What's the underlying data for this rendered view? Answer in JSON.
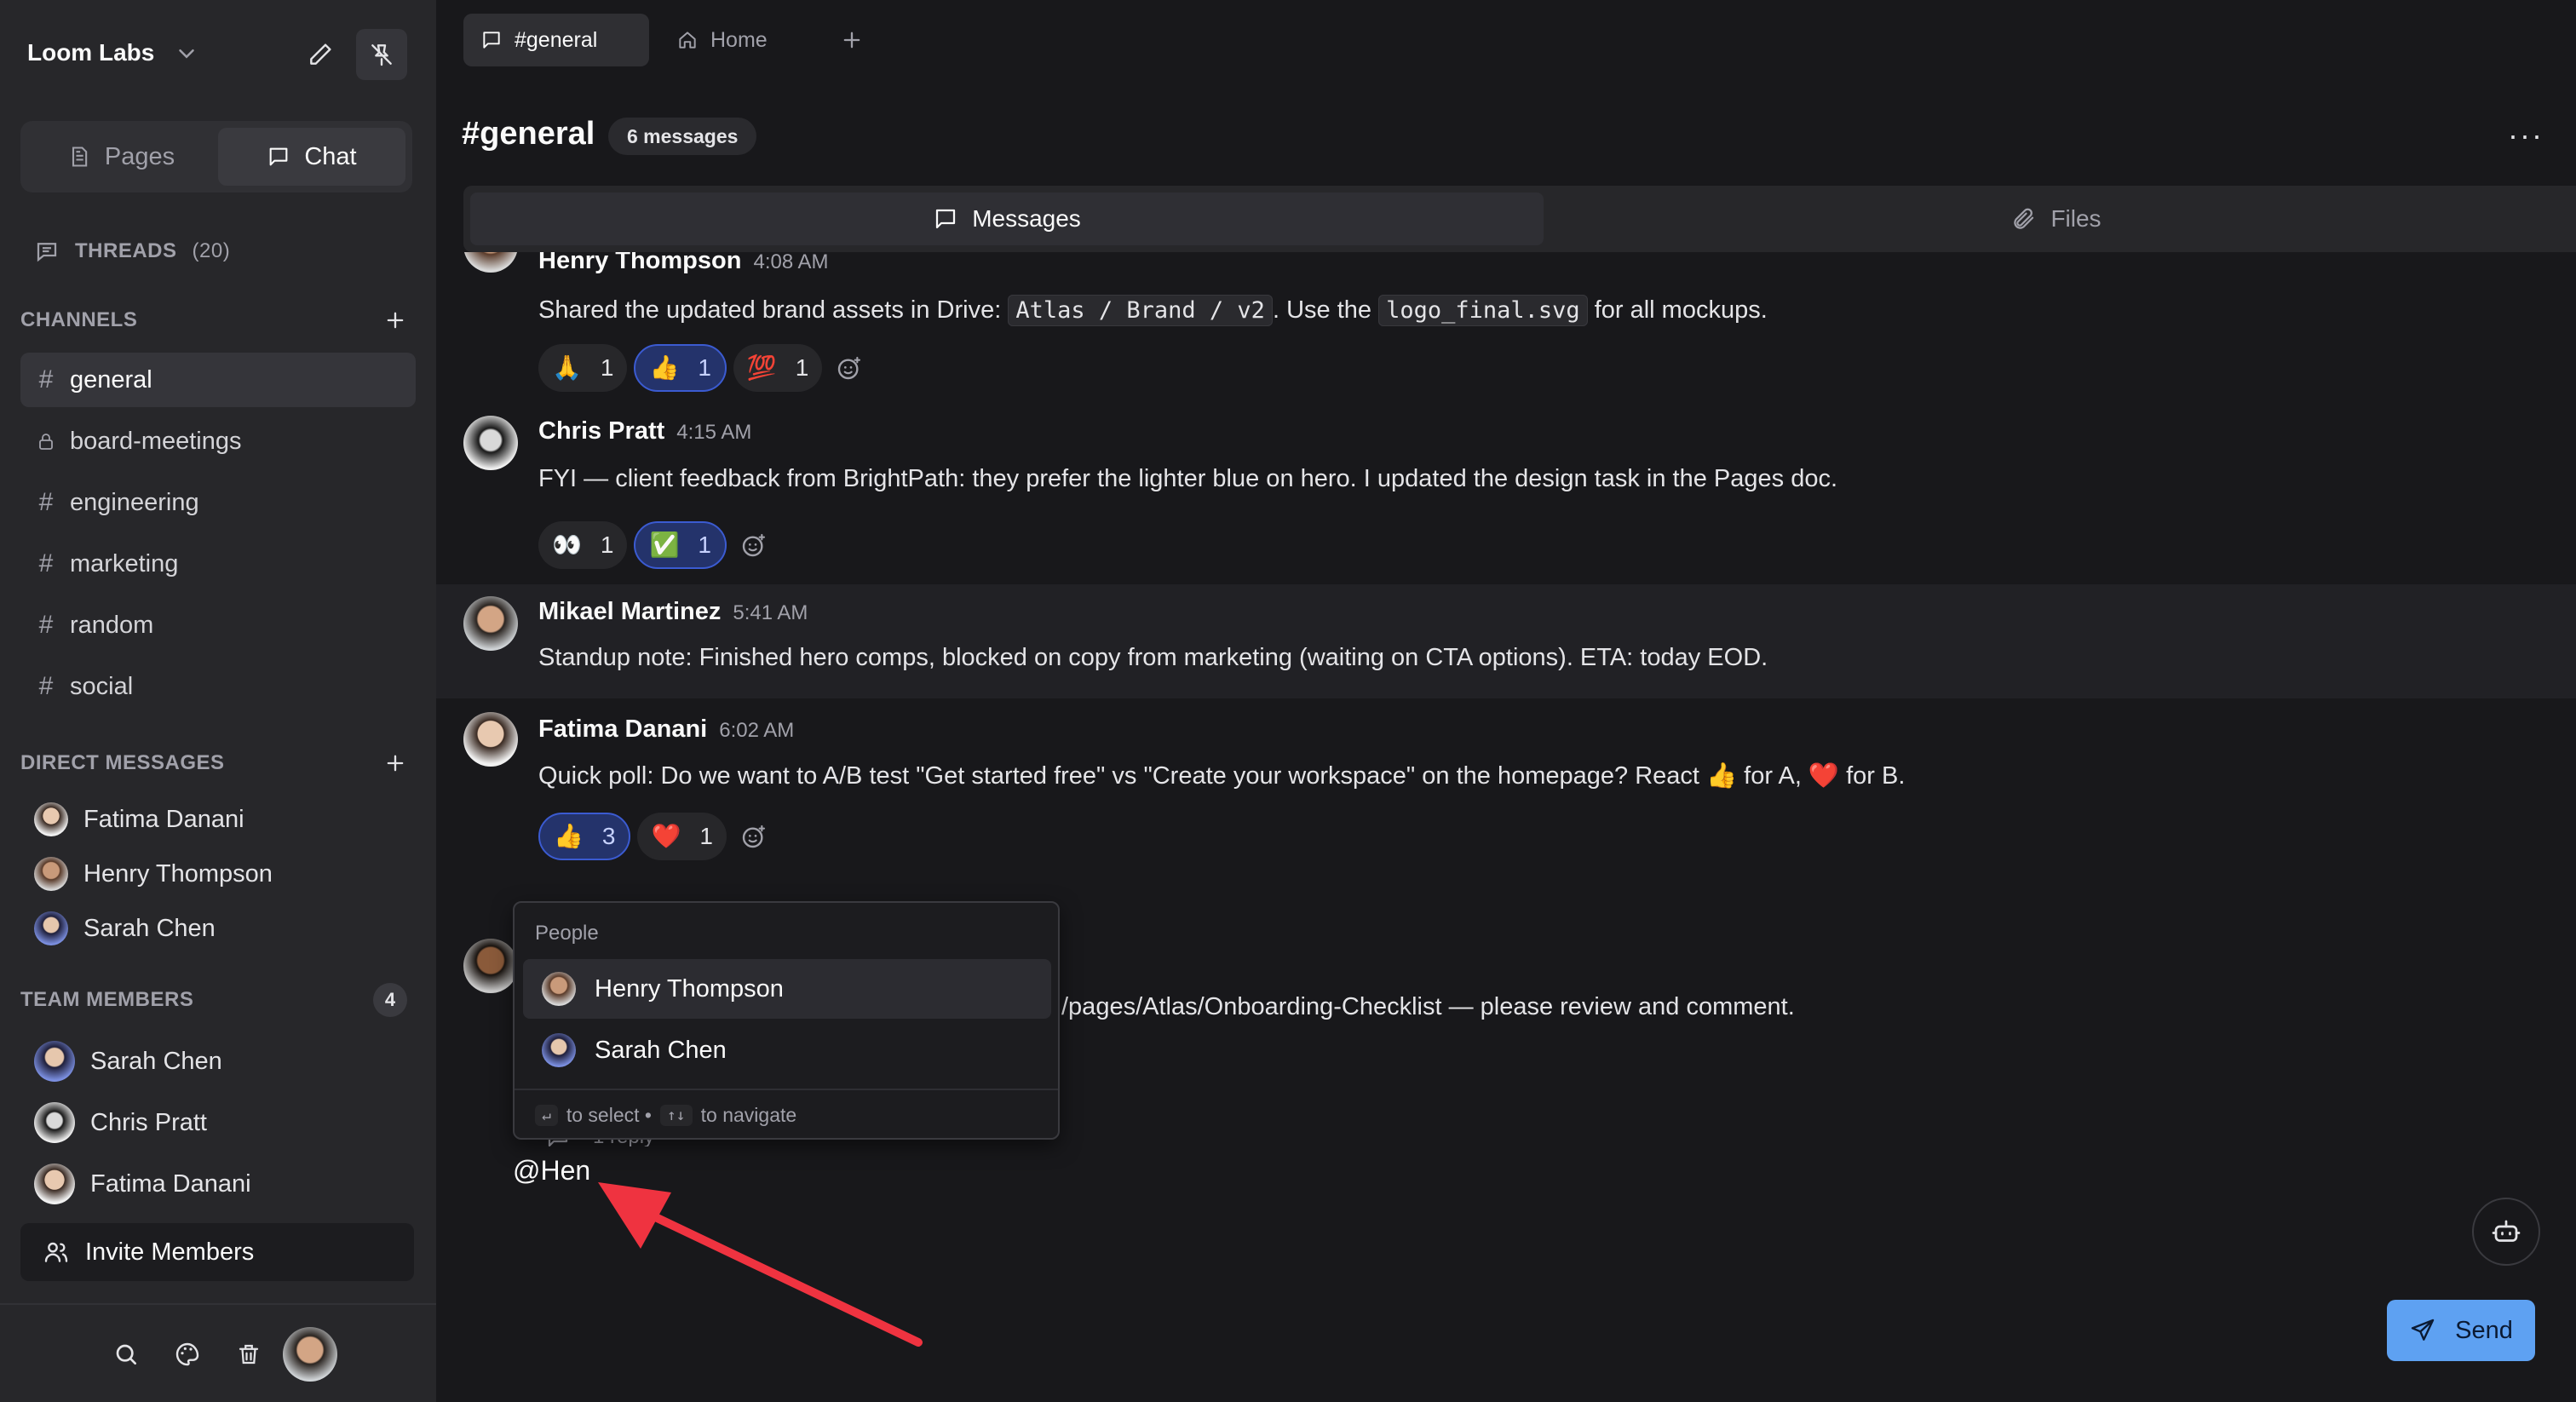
{
  "workspace": {
    "name": "Loom Labs"
  },
  "sidebar": {
    "tabs": [
      {
        "label": "Pages"
      },
      {
        "label": "Chat"
      }
    ],
    "threads": {
      "label": "THREADS",
      "count": "(20)"
    },
    "channels_label": "CHANNELS",
    "channels": [
      {
        "name": "general",
        "icon": "hash-icon",
        "active": true
      },
      {
        "name": "board-meetings",
        "icon": "lock-icon"
      },
      {
        "name": "engineering",
        "icon": "hash-icon"
      },
      {
        "name": "marketing",
        "icon": "hash-icon"
      },
      {
        "name": "random",
        "icon": "hash-icon"
      },
      {
        "name": "social",
        "icon": "hash-icon"
      }
    ],
    "dm_label": "DIRECT MESSAGES",
    "dms": [
      {
        "name": "Fatima Danani"
      },
      {
        "name": "Henry Thompson"
      },
      {
        "name": "Sarah Chen"
      }
    ],
    "team_label": "TEAM MEMBERS",
    "team_count": "4",
    "team": [
      {
        "name": "Sarah Chen"
      },
      {
        "name": "Chris Pratt"
      },
      {
        "name": "Fatima Danani"
      }
    ],
    "invite_label": "Invite Members"
  },
  "tabs": [
    {
      "label": "#general"
    },
    {
      "label": "Home"
    }
  ],
  "channel": {
    "title": "#general",
    "message_count": "6 messages",
    "more": "···"
  },
  "subtabs": [
    {
      "label": "Messages"
    },
    {
      "label": "Files"
    }
  ],
  "messages": [
    {
      "author": "Henry Thompson",
      "time": "4:08 AM",
      "text_before": "Shared the updated brand assets in Drive: ",
      "code1": "Atlas / Brand / v2",
      "text_mid": ". Use the ",
      "code2": "logo_final.svg",
      "text_after": " for all mockups.",
      "reactions": [
        {
          "emoji": "🙏",
          "count": "1"
        },
        {
          "emoji": "👍",
          "count": "1",
          "mine": true
        },
        {
          "emoji": "💯",
          "count": "1"
        }
      ]
    },
    {
      "author": "Chris Pratt",
      "time": "4:15 AM",
      "text": "FYI — client feedback from BrightPath: they prefer the lighter blue on hero. I updated the design task in the Pages doc.",
      "reactions": [
        {
          "emoji": "👀",
          "count": "1"
        },
        {
          "emoji": "✅",
          "count": "1",
          "mine": true
        }
      ]
    },
    {
      "author": "Mikael Martinez",
      "time": "5:41 AM",
      "text": "Standup note: Finished hero comps, blocked on copy from marketing (waiting on CTA options). ETA: today EOD."
    },
    {
      "author": "Fatima Danani",
      "time": "6:02 AM",
      "text": "Quick poll: Do we want to A/B test \"Get started free\" vs \"Create your workspace\" on the homepage? React 👍 for A, ❤️ for B.",
      "reactions": [
        {
          "emoji": "👍",
          "count": "3",
          "mine": true
        },
        {
          "emoji": "❤️",
          "count": "1"
        }
      ],
      "replies": "1 reply"
    },
    {
      "author": "",
      "text_visible": "/pages/Atlas/Onboarding-Checklist — please review and comment."
    }
  ],
  "mention_popup": {
    "header": "People",
    "items": [
      {
        "name": "Henry Thompson",
        "selected": true
      },
      {
        "name": "Sarah Chen"
      }
    ],
    "footer_select": "to select •",
    "footer_navigate": "to navigate",
    "key_enter": "↵",
    "key_arrows": "↑↓"
  },
  "composer": {
    "value": "@Hen",
    "send_label": "Send"
  },
  "colors": {
    "accent": "#5ea1f2",
    "annotation_arrow": "#ef3340",
    "sidebar_bg": "#27272a",
    "main_bg": "#18181b"
  }
}
